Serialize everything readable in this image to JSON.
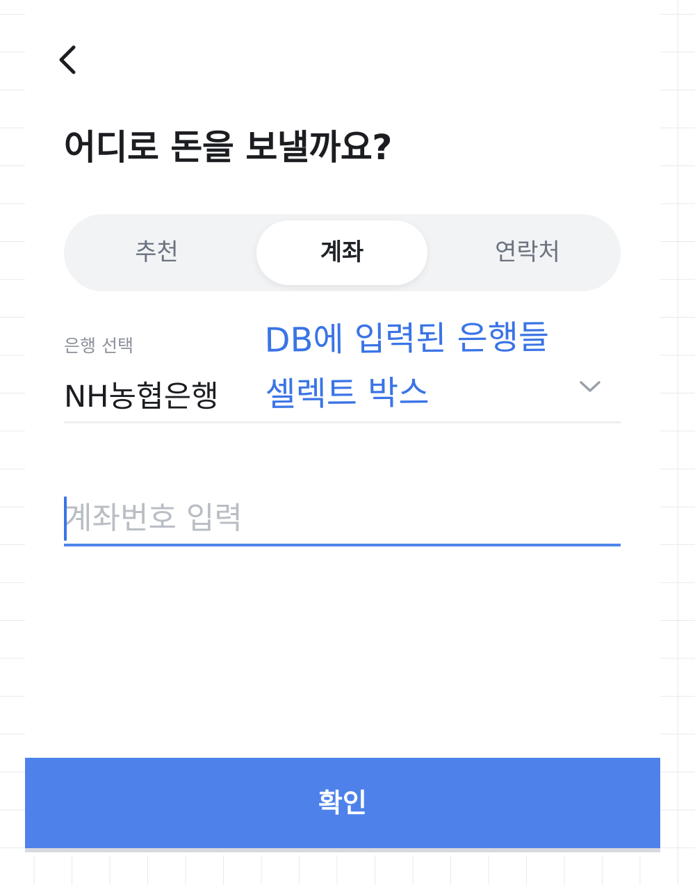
{
  "page": {
    "title": "어디로 돈을 보낼까요?"
  },
  "tabs": [
    {
      "label": "추천",
      "active": false
    },
    {
      "label": "계좌",
      "active": true
    },
    {
      "label": "연락처",
      "active": false
    }
  ],
  "bank_select": {
    "label": "은행 선택",
    "value": "NH농협은행"
  },
  "annotation": {
    "line1": "DB에 입력된 은행들",
    "line2": "셀렉트 박스",
    "color": "#3a74e6"
  },
  "account_input": {
    "placeholder": "계좌번호 입력",
    "value": ""
  },
  "confirm_button": {
    "label": "확인",
    "color": "#4e82ea"
  },
  "icons": {
    "back": "chevron-left-icon",
    "select": "chevron-down-icon"
  }
}
